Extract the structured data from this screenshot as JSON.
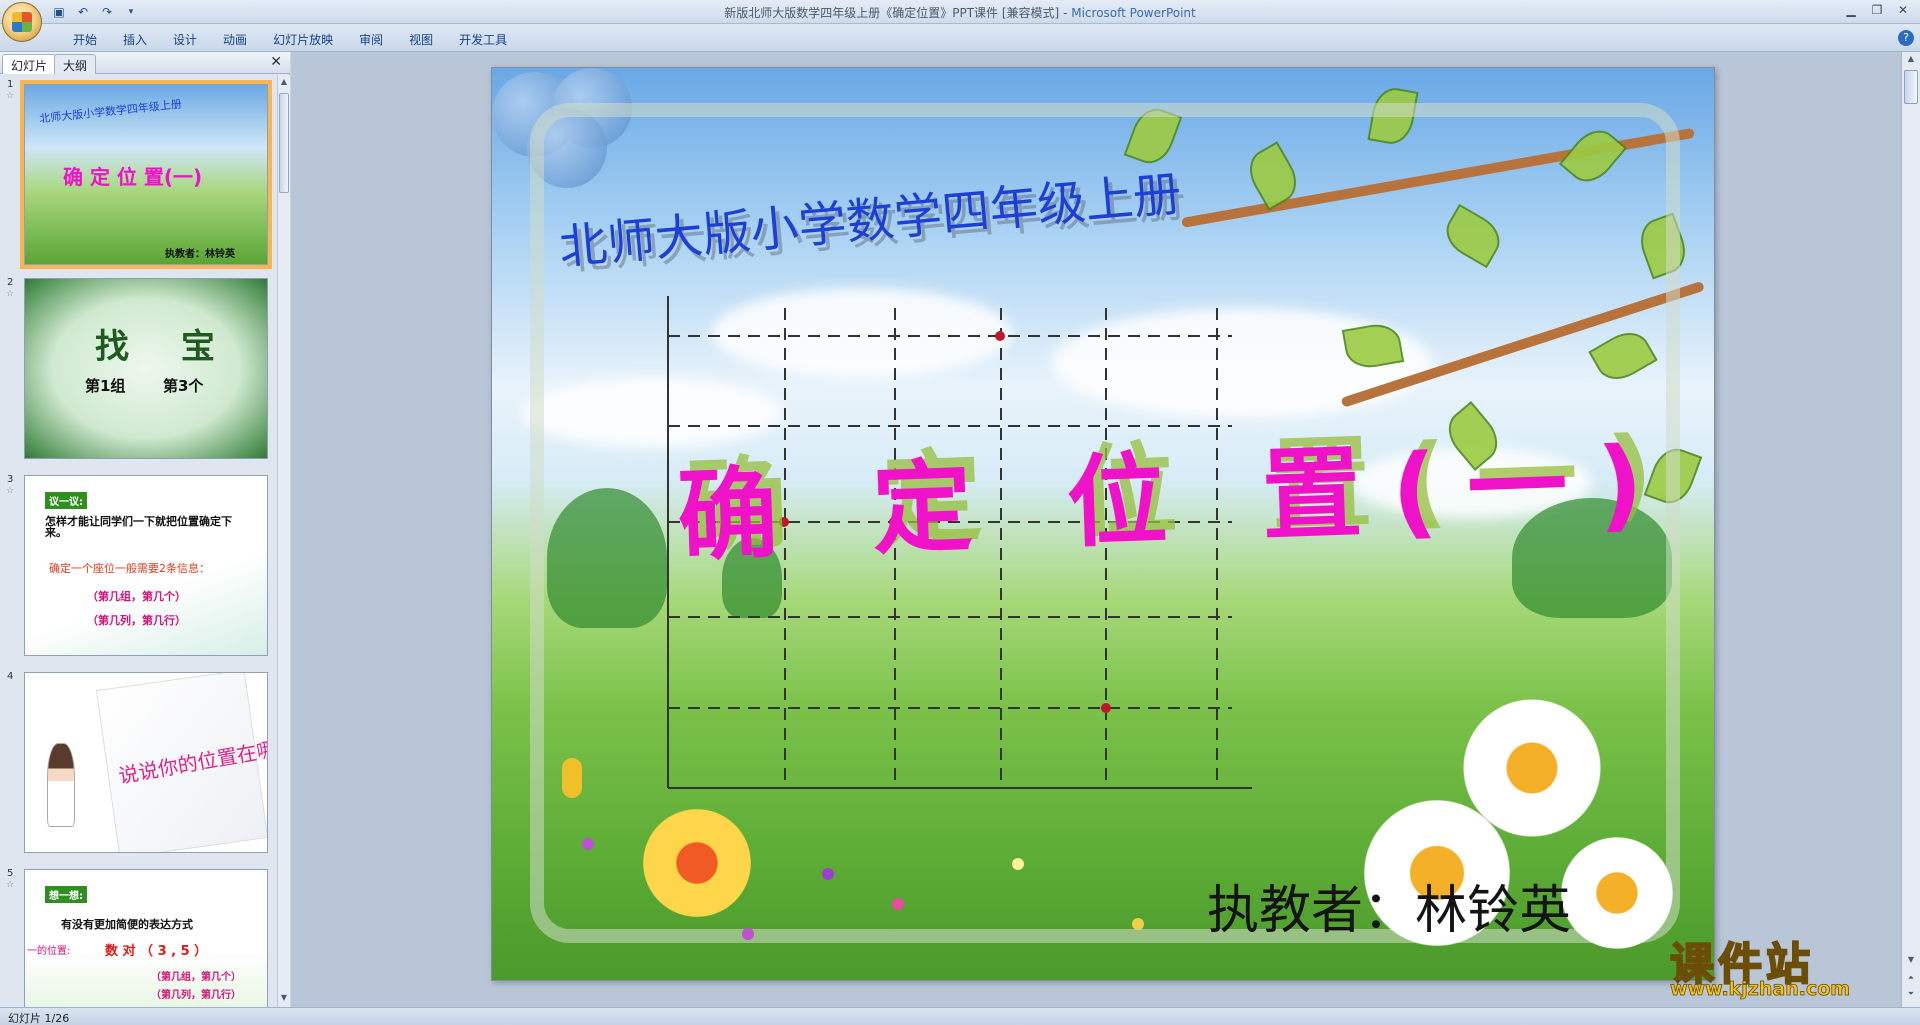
{
  "window": {
    "title": "新版北师大版数学四年级上册《确定位置》PPT课件 [兼容模式]",
    "app_name": "Microsoft PowerPoint",
    "separator": "-"
  },
  "quick_access": {
    "save_icon": "save-icon",
    "undo_icon": "undo-icon",
    "redo_icon": "redo-icon",
    "customize_icon": "chevron-down-icon"
  },
  "ribbon": {
    "tabs": [
      "开始",
      "插入",
      "设计",
      "动画",
      "幻灯片放映",
      "审阅",
      "视图",
      "开发工具"
    ],
    "help": "?"
  },
  "pane": {
    "tab_slides": "幻灯片",
    "tab_outline": "大纲",
    "close": "✕"
  },
  "thumbnails": [
    {
      "num": "1",
      "subtitle": "北师大版小学数学四年级上册",
      "title": "确 定 位 置(一)",
      "author": "执教者：林铃英"
    },
    {
      "num": "2",
      "title": "找 宝",
      "group": "第1组",
      "pos": "第3个"
    },
    {
      "num": "3",
      "tag": "议一议:",
      "question": "怎样才能让同学们一下就把位置确定下来。",
      "line1": "确定一个座位一般需要2条信息：",
      "line2": "（第几组，第几个）",
      "line3": "（第几列，第几行）"
    },
    {
      "num": "4",
      "text": "说说你的位置在哪里？"
    },
    {
      "num": "5",
      "tag": "想一想:",
      "question": "有没有更加简便的表达方式",
      "left_label": "一的位置:",
      "pair": "数 对 （ 3 , 5 ）",
      "line1": "（第几组，第几个）",
      "line2": "（第几列，第几行）"
    }
  ],
  "slide": {
    "subtitle": "北师大版小学数学四年级上册",
    "title": "确 定 位 置(一)",
    "author": "执教者：林铃英"
  },
  "status": {
    "slide_counter": "幻灯片 1/26"
  },
  "watermark": {
    "top": "课件站",
    "bottom": "www.kjzhan.com"
  },
  "colors": {
    "title_magenta": "#f012c8",
    "subtitle_blue": "#1d3fd6",
    "selection_orange": "#f8b553"
  }
}
